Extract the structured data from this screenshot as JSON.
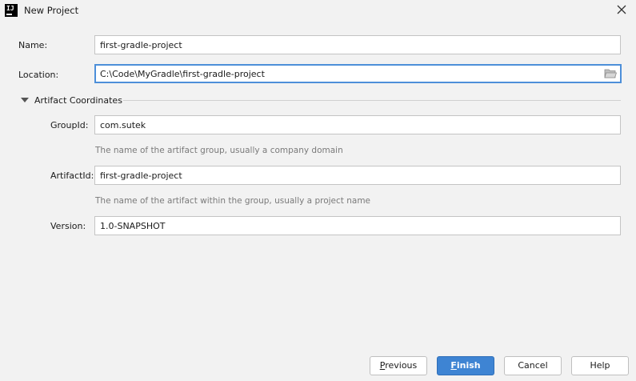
{
  "window": {
    "title": "New Project",
    "logo_text": "IJ"
  },
  "form": {
    "name": {
      "label": "Name:",
      "value": "first-gradle-project"
    },
    "location": {
      "label": "Location:",
      "value": "C:\\Code\\MyGradle\\first-gradle-project"
    }
  },
  "artifact_section": {
    "title": "Artifact Coordinates",
    "expanded": true,
    "group_id": {
      "label": "GroupId:",
      "value": "com.sutek",
      "hint": "The name of the artifact group, usually a company domain"
    },
    "artifact_id": {
      "label": "ArtifactId:",
      "value": "first-gradle-project",
      "hint": "The name of the artifact within the group, usually a project name"
    },
    "version": {
      "label": "Version:",
      "value": "1.0-SNAPSHOT"
    }
  },
  "buttons": {
    "previous": {
      "mnemonic": "P",
      "rest": "revious"
    },
    "finish": {
      "mnemonic": "F",
      "rest": "inish"
    },
    "cancel": "Cancel",
    "help": "Help"
  },
  "colors": {
    "primary_button": "#3e84d3",
    "focus_border": "#4d8fd9",
    "dialog_background": "#f2f2f2"
  }
}
